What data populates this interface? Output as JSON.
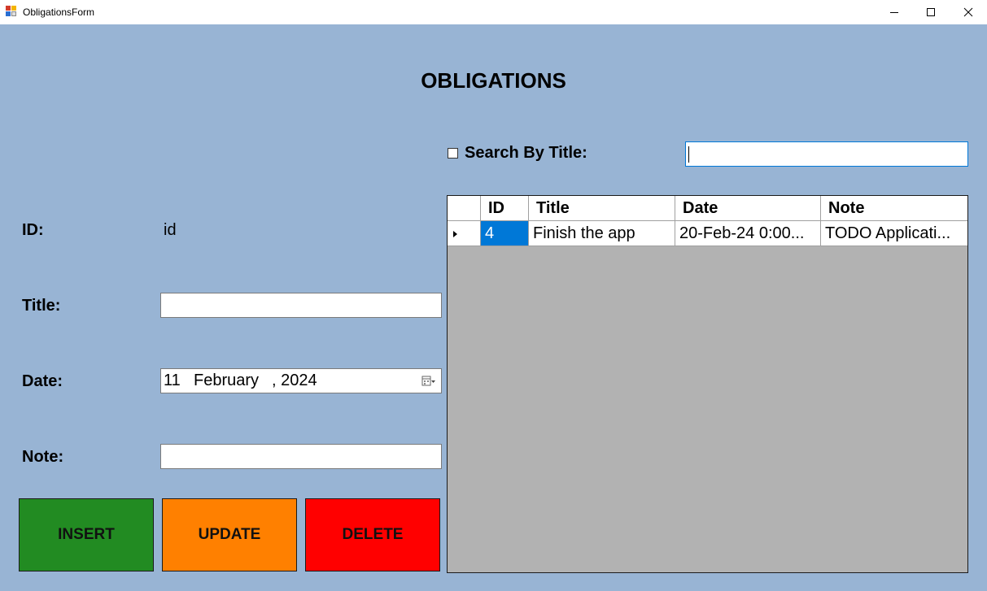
{
  "window": {
    "title": "ObligationsForm",
    "controls": [
      "minimize-icon",
      "maximize-icon",
      "close-icon"
    ]
  },
  "heading": "OBLIGATIONS",
  "form": {
    "id_label": "ID:",
    "id_value": "id",
    "title_label": "Title:",
    "title_value": "",
    "date_label": "Date:",
    "date_day": "11",
    "date_month": "February",
    "date_year": ", 2024",
    "note_label": "Note:",
    "note_value": ""
  },
  "buttons": {
    "insert": "INSERT",
    "update": "UPDATE",
    "delete": "DELETE"
  },
  "search": {
    "checked": false,
    "label": "Search By Title:",
    "value": ""
  },
  "grid": {
    "columns": [
      "ID",
      "Title",
      "Date",
      "Note"
    ],
    "rows": [
      [
        "4",
        "Finish the app",
        "20-Feb-24 0:00...",
        "TODO Applicati..."
      ]
    ]
  },
  "colors": {
    "background": "#98b4d4",
    "insert": "#228b22",
    "update": "#ff8000",
    "delete": "#ff0000",
    "selection": "#0078d7",
    "grid_empty": "#b2b2b2"
  }
}
